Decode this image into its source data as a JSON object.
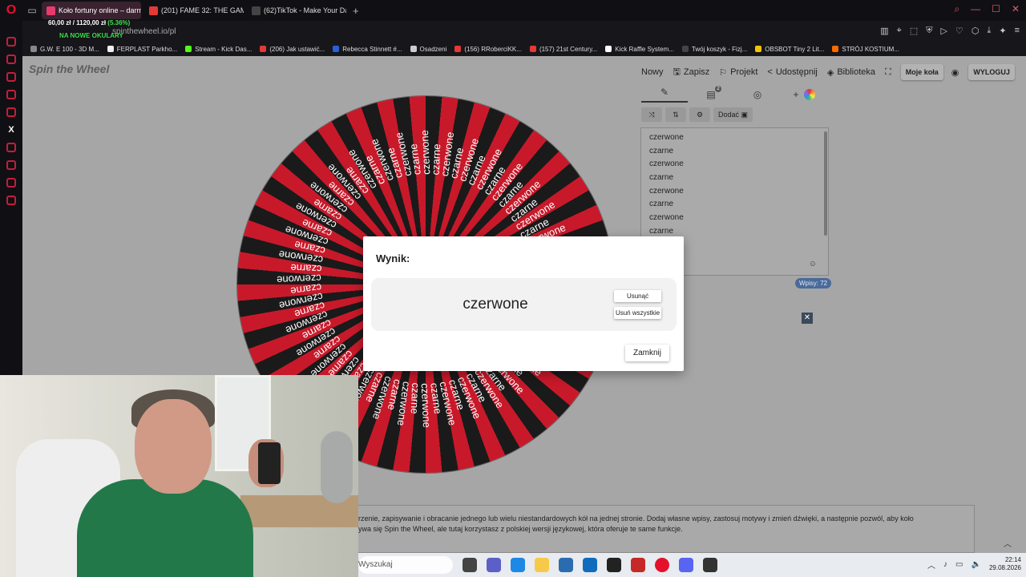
{
  "browser": {
    "tabs": [
      {
        "label": "Koło fortuny online – darmo",
        "active": true,
        "color": "#e83b6b"
      },
      {
        "label": "(201) FAME 32: THE GAME",
        "active": false,
        "color": "#e53935"
      },
      {
        "label": "(62)TikTok - Make Your Day",
        "active": false,
        "color": "#222222"
      }
    ],
    "add_tab": "+",
    "url": "spinthewheel.io/pl",
    "overlay_price": "60,00 zł / 1120,00 zł",
    "overlay_pct": "(5.36%)",
    "overlay_glasses": "NA NOWE OKULARY",
    "bookmarks": [
      {
        "label": "G.W. E 100 - 3D M...",
        "color": "#888888"
      },
      {
        "label": "FERPLAST Parkho...",
        "color": "#eeeeee"
      },
      {
        "label": "Stream - Kick Das...",
        "color": "#53fc18"
      },
      {
        "label": "(206) Jak ustawić...",
        "color": "#e53935"
      },
      {
        "label": "Rebecca Stinnett #...",
        "color": "#2b5fd9"
      },
      {
        "label": "Osadzeni",
        "color": "#cccccc"
      },
      {
        "label": "(156) RRoberciKK...",
        "color": "#e53935"
      },
      {
        "label": "(157) 21st Century...",
        "color": "#e53935"
      },
      {
        "label": "Kick Raffle System...",
        "color": "#ffffff"
      },
      {
        "label": "Twój koszyk - Fizj...",
        "color": "#444444"
      },
      {
        "label": "OBSBOT Tiny 2 Lit...",
        "color": "#f5c400"
      },
      {
        "label": "STRÓJ KOSTIUM...",
        "color": "#ff6a00"
      }
    ]
  },
  "app": {
    "brand": "Spin the Wheel",
    "nav": {
      "new": "Nowy",
      "save": "Zapisz",
      "project": "Projekt",
      "share": "Udostępnij",
      "library": "Biblioteka",
      "my_wheels": "Moje koła",
      "logout": "WYLOGUJ"
    },
    "editor": {
      "badge": "2",
      "add_plus": "+",
      "add_image": "Dodać",
      "entries": [
        "czerwone",
        "czarne",
        "czerwone",
        "czarne",
        "czerwone",
        "czarne",
        "czerwone",
        "czarne"
      ],
      "count": "Wpisy: 72"
    },
    "wheel": {
      "labels": [
        "czerwone",
        "czarne"
      ]
    },
    "description_line1": "rzenie, zapisywanie i obracanie jednego lub wielu niestandardowych kół na jednej stronie. Dodaj własne wpisy, zastosuj motywy i zmień dźwięki, a następnie pozwól, aby koło",
    "description_line2": "ywa się Spin the Wheel, ale tutaj korzystasz z polskiej wersji językowej, która oferuje te same funkcje."
  },
  "modal": {
    "title": "Wynik:",
    "result": "czerwone",
    "remove": "Usunąć",
    "remove_all": "Usuń wszystkie",
    "close": "Zamknij"
  },
  "taskbar": {
    "search_placeholder": "Wyszukaj",
    "time": "22:14",
    "date": "29.08.2026"
  },
  "colors": {
    "wheel_red": "#c8192a",
    "wheel_black": "#1a1a1a",
    "accent": "#e5112c"
  }
}
